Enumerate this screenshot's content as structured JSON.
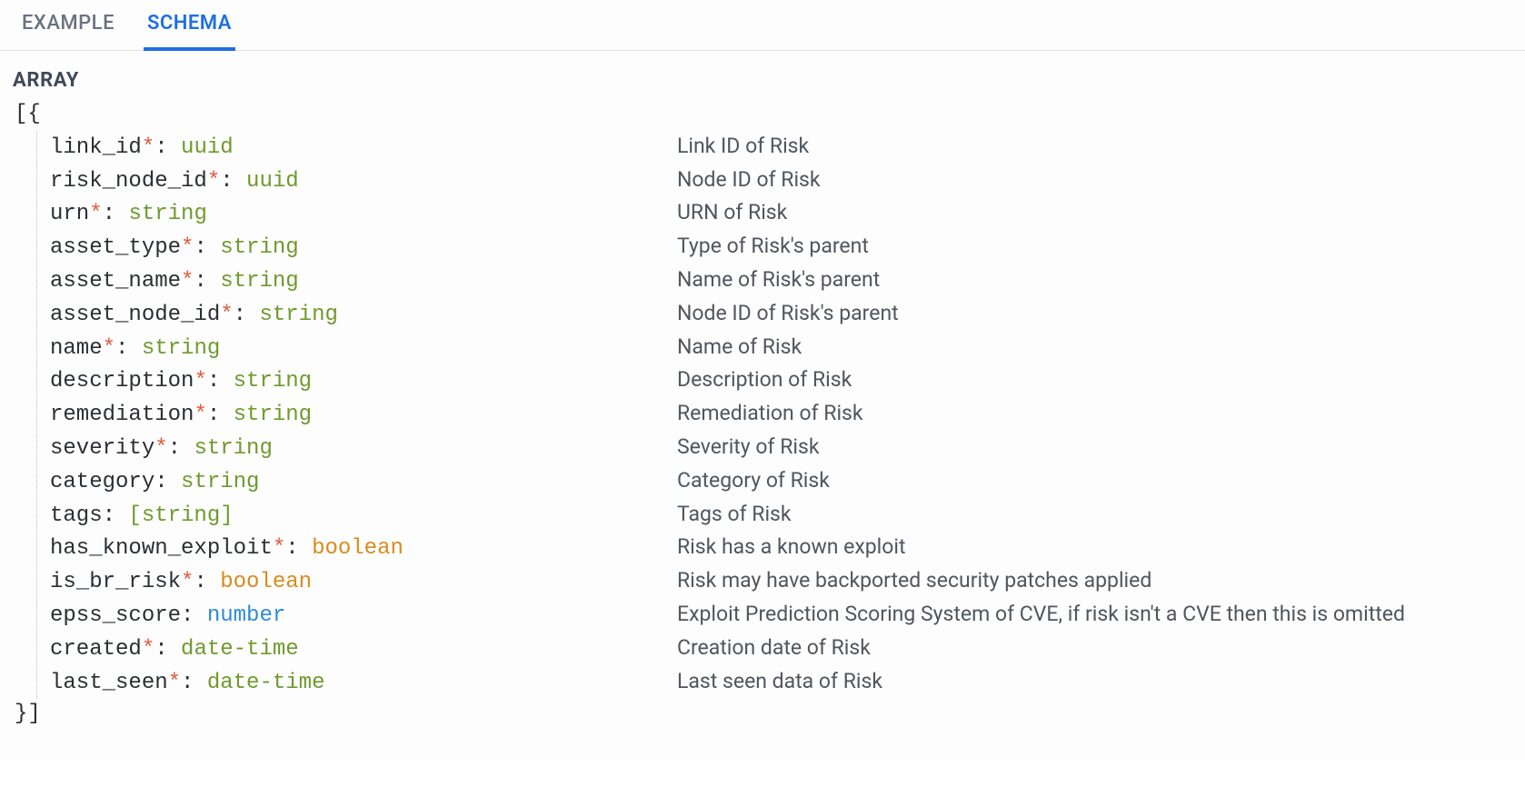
{
  "tabs": {
    "example": "EXAMPLE",
    "schema": "SCHEMA"
  },
  "type_label": "ARRAY",
  "open_bracket": "[{",
  "close_bracket": "}]",
  "fields": [
    {
      "name": "link_id",
      "required": true,
      "type": "uuid",
      "type_class": "type-uuid",
      "desc": "Link ID of Risk"
    },
    {
      "name": "risk_node_id",
      "required": true,
      "type": "uuid",
      "type_class": "type-uuid",
      "desc": "Node ID of Risk"
    },
    {
      "name": "urn",
      "required": true,
      "type": "string",
      "type_class": "type-string",
      "desc": "URN of Risk"
    },
    {
      "name": "asset_type",
      "required": true,
      "type": "string",
      "type_class": "type-string",
      "desc": "Type of Risk's parent"
    },
    {
      "name": "asset_name",
      "required": true,
      "type": "string",
      "type_class": "type-string",
      "desc": "Name of Risk's parent"
    },
    {
      "name": "asset_node_id",
      "required": true,
      "type": "string",
      "type_class": "type-string",
      "desc": "Node ID of Risk's parent"
    },
    {
      "name": "name",
      "required": true,
      "type": "string",
      "type_class": "type-string",
      "desc": "Name of Risk"
    },
    {
      "name": "description",
      "required": true,
      "type": "string",
      "type_class": "type-string",
      "desc": "Description of Risk"
    },
    {
      "name": "remediation",
      "required": true,
      "type": "string",
      "type_class": "type-string",
      "desc": "Remediation of Risk"
    },
    {
      "name": "severity",
      "required": true,
      "type": "string",
      "type_class": "type-string",
      "desc": "Severity of Risk"
    },
    {
      "name": "category",
      "required": false,
      "type": "string",
      "type_class": "type-string",
      "desc": "Category of Risk"
    },
    {
      "name": "tags",
      "required": false,
      "type": "[string]",
      "type_class": "type-stringarr",
      "desc": "Tags of Risk"
    },
    {
      "name": "has_known_exploit",
      "required": true,
      "type": "boolean",
      "type_class": "type-boolean",
      "desc": "Risk has a known exploit"
    },
    {
      "name": "is_br_risk",
      "required": true,
      "type": "boolean",
      "type_class": "type-boolean",
      "desc": "Risk may have backported security patches applied"
    },
    {
      "name": "epss_score",
      "required": false,
      "type": "number",
      "type_class": "type-number",
      "desc": "Exploit Prediction Scoring System of CVE, if risk isn't a CVE then this is omitted"
    },
    {
      "name": "created",
      "required": true,
      "type": "date-time",
      "type_class": "type-datetime",
      "desc": "Creation date of Risk"
    },
    {
      "name": "last_seen",
      "required": true,
      "type": "date-time",
      "type_class": "type-datetime",
      "desc": "Last seen data of Risk"
    }
  ]
}
